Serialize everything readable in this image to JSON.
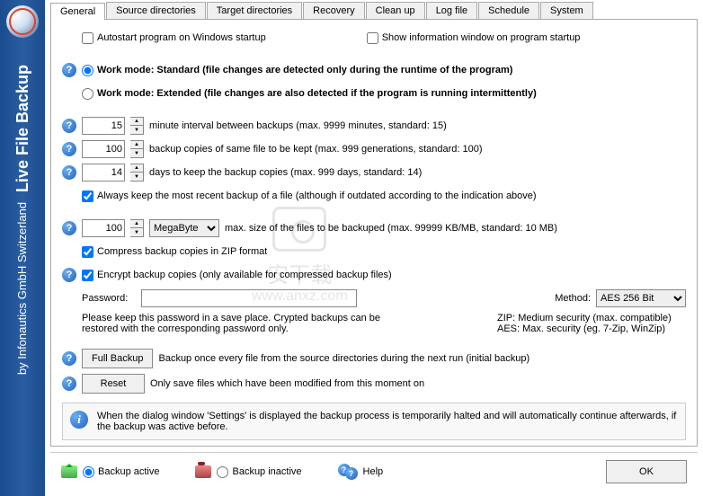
{
  "sidebar": {
    "company": "by Infonautics GmbH Switzerland",
    "title": "Live File Backup"
  },
  "tabs": [
    "General",
    "Source directories",
    "Target directories",
    "Recovery",
    "Clean up",
    "Log file",
    "Schedule",
    "System"
  ],
  "checkboxes": {
    "autostart": "Autostart program on Windows startup",
    "show_info": "Show information window on program startup",
    "always_keep": "Always keep the most recent backup of a file (although if outdated according to the indication above)",
    "compress": "Compress backup copies in ZIP format",
    "encrypt": "Encrypt backup copies (only available for compressed backup files)"
  },
  "radios": {
    "standard": "Work mode: Standard (file changes are detected only during the runtime of the program)",
    "extended": "Work mode: Extended (file changes are also detected if the program is running intermittently)",
    "active": "Backup active",
    "inactive": "Backup inactive"
  },
  "fields": {
    "interval": {
      "value": "15",
      "label": "minute interval between backups (max. 9999 minutes, standard: 15)"
    },
    "copies": {
      "value": "100",
      "label": "backup copies of same file to be kept (max. 999 generations, standard: 100)"
    },
    "days": {
      "value": "14",
      "label": "days to keep the backup copies (max. 999 days, standard: 14)"
    },
    "maxsize": {
      "value": "100",
      "unit": "MegaByte",
      "label": "max. size of the files to be backuped (max. 99999 KB/MB, standard: 10 MB)"
    }
  },
  "password": {
    "label": "Password:",
    "note": "Please keep this password in a save place. Crypted backups can be restored with the corresponding password only.",
    "method_label": "Method:",
    "method_value": "AES 256 Bit",
    "method_note": "ZIP: Medium security (max. compatible)\nAES: Max. security (eg. 7-Zip, WinZip)"
  },
  "buttons": {
    "full_backup": {
      "label": "Full Backup",
      "desc": "Backup once every file from the source directories during the next run (initial backup)"
    },
    "reset": {
      "label": "Reset",
      "desc": "Only save files which have been modified from this moment on"
    },
    "help": "Help",
    "ok": "OK"
  },
  "info_note": "When the dialog window 'Settings' is displayed the backup process is temporarily halted and will automatically continue afterwards, if the backup was active before.",
  "watermark": {
    "text1": "安下载",
    "text2": "www.anxz.com"
  }
}
